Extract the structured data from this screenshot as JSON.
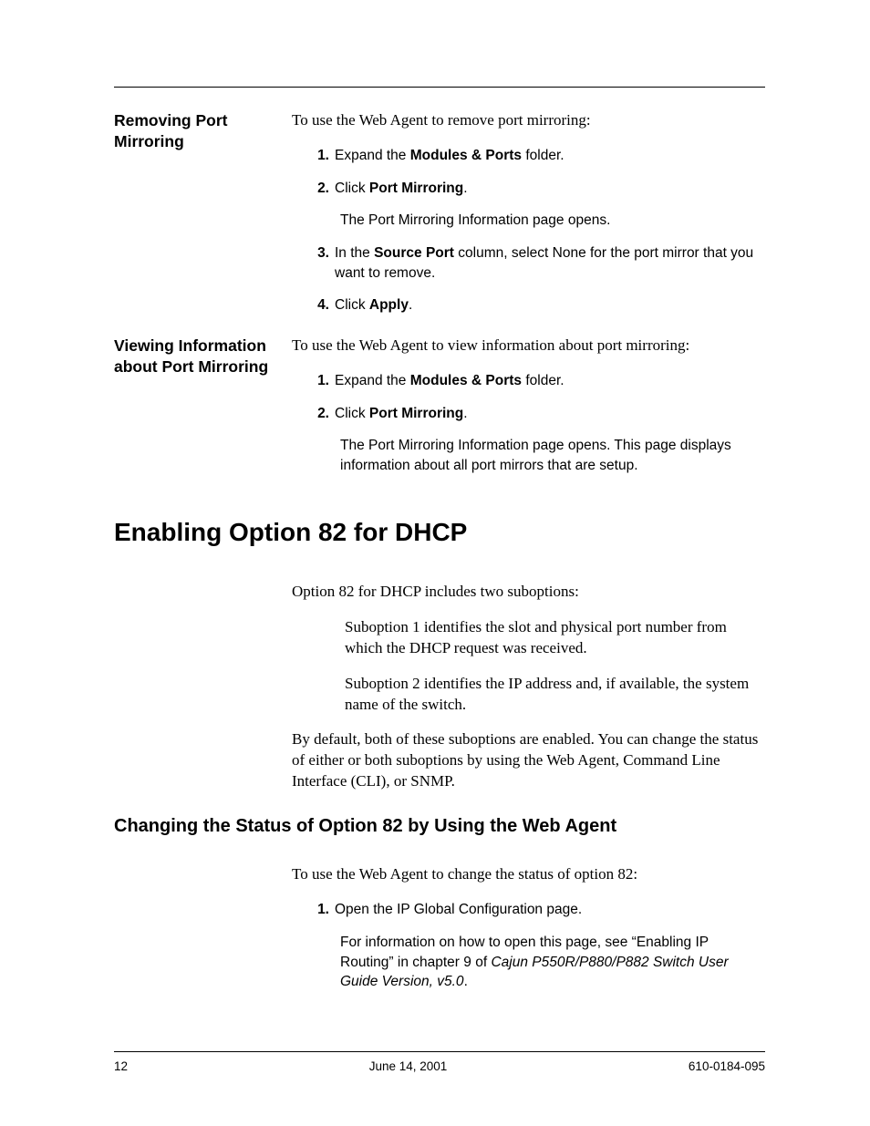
{
  "section1": {
    "heading": "Removing Port Mirroring",
    "intro": "To use the Web Agent to remove port mirroring:",
    "s1_pre": "Expand the ",
    "s1_b": "Modules & Ports",
    "s1_post": " folder.",
    "s2_pre": "Click ",
    "s2_b": "Port Mirroring",
    "s2_post": ".",
    "s2_result": "The Port Mirroring Information page opens.",
    "s3_pre": "In the ",
    "s3_b": "Source Port",
    "s3_post": " column, select None for the port mirror that you want to remove.",
    "s4_pre": "Click ",
    "s4_b": "Apply",
    "s4_post": "."
  },
  "section2": {
    "heading": "Viewing Information about Port Mirroring",
    "intro": "To use the Web Agent to view information about port mirroring:",
    "s1_pre": "Expand the ",
    "s1_b": "Modules & Ports",
    "s1_post": " folder.",
    "s2_pre": "Click ",
    "s2_b": "Port Mirroring",
    "s2_post": ".",
    "s2_result": "The Port Mirroring Information page opens. This page displays information about all port mirrors that are setup."
  },
  "h1": "Enabling Option 82 for DHCP",
  "opt82": {
    "intro": "Option 82 for DHCP includes two suboptions:",
    "sub1": "Suboption 1 identifies the slot and physical port number from which the DHCP request was received.",
    "sub2": "Suboption 2 identifies the IP address and, if available, the system name of the switch.",
    "default": "By default, both of these suboptions are enabled. You can change the status of either or both suboptions by using the Web Agent, Command Line Interface (CLI), or SNMP."
  },
  "h2": "Changing the Status of Option 82 by Using the Web Agent",
  "web82": {
    "intro": "To use the Web Agent to change the status of option 82:",
    "s1": "Open the IP Global Configuration page.",
    "s1_result_pre": "For information on how to open this page, see “Enabling IP Routing” in chapter 9 of ",
    "s1_result_it": "Cajun P550R/P880/P882 Switch User Guide Version, v5.0",
    "s1_result_post": "."
  },
  "footer": {
    "page": "12",
    "date": "June 14, 2001",
    "doc": "610-0184-095"
  }
}
